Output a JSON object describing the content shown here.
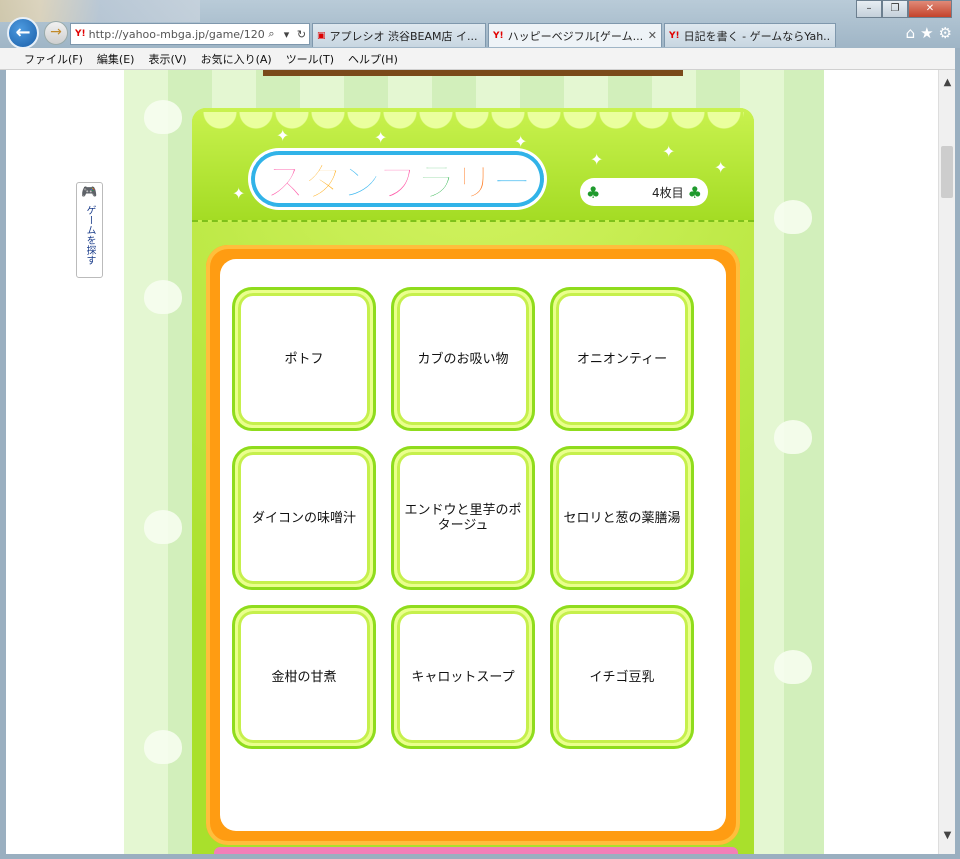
{
  "browser": {
    "address_url": "http://yahoo-mbga.jp/game/120",
    "tabs": [
      {
        "label": "アプレシオ 渋谷BEAM店 イ...",
        "active": false
      },
      {
        "label": "ハッピーベジフル[ゲーム...",
        "active": true
      },
      {
        "label": "日記を書く - ゲームならYah...",
        "active": false
      }
    ],
    "menu": [
      "ファイル(F)",
      "編集(E)",
      "表示(V)",
      "お気に入り(A)",
      "ツール(T)",
      "ヘルプ(H)"
    ],
    "window_buttons": [
      "minimize",
      "restore",
      "close"
    ],
    "toolbar_icons": [
      "home-icon",
      "star-icon",
      "gear-icon"
    ]
  },
  "side_tab": {
    "label": "ゲームを探す",
    "icon": "gamepad-icon"
  },
  "game": {
    "title": "スタンプラリー",
    "title_colors": [
      "#ff5aa8",
      "#ffb020",
      "#3db8f0",
      "#ff5aa8",
      "#2bb34a",
      "#ff7a20",
      "#3db8f0"
    ],
    "ticket_count": "4枚目",
    "stamps": [
      "ポトフ",
      "カブのお吸い物",
      "オニオンティー",
      "ダイコンの味噌汁",
      "エンドウと里芋のポタージュ",
      "セロリと葱の薬膳湯",
      "金柑の甘煮",
      "キャロットスープ",
      "イチゴ豆乳"
    ]
  },
  "colors": {
    "panel_green": "#a9e02c",
    "board_orange": "#ff9c12",
    "stamp_border": "#8fdc1d"
  }
}
